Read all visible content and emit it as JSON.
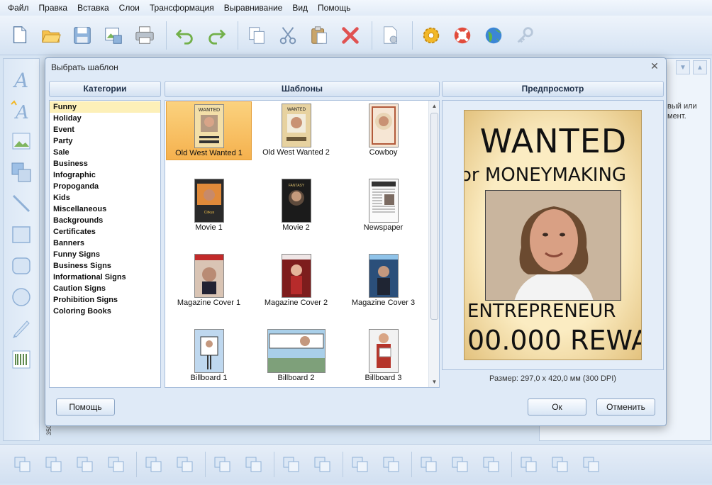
{
  "menu": [
    "Файл",
    "Правка",
    "Вставка",
    "Слои",
    "Трансформация",
    "Выравнивание",
    "Вид",
    "Помощь"
  ],
  "toolbar_icons": [
    "new-document-icon",
    "open-folder-icon",
    "save-icon",
    "export-image-icon",
    "print-icon",
    "undo-icon",
    "redo-icon",
    "copy-icon",
    "cut-icon",
    "paste-icon",
    "delete-icon",
    "page-settings-icon",
    "settings-gear-icon",
    "help-lifebuoy-icon",
    "web-globe-icon",
    "key-icon"
  ],
  "left_tools": [
    "text-icon",
    "curved-text-icon",
    "image-icon",
    "clipart-icon",
    "line-icon",
    "rectangle-icon",
    "rounded-rectangle-icon",
    "ellipse-icon",
    "pencil-icon",
    "barcode-icon"
  ],
  "bottom_icons": [
    "bring-front-icon",
    "send-back-icon",
    "bring-forward-icon",
    "send-backward-icon",
    "group-icon",
    "ungroup-icon",
    "center-horizontal-icon",
    "center-vertical-icon",
    "rotate-left-icon",
    "rotate-right-icon",
    "flip-horizontal-icon",
    "flip-vertical-icon",
    "align-left-icon",
    "align-center-icon",
    "align-right-icon",
    "align-top-icon",
    "align-middle-icon",
    "align-bottom-icon"
  ],
  "right_panel": {
    "text": "вый или\nмент."
  },
  "ruler_label": "350",
  "dialog": {
    "title": "Выбрать шаблон",
    "categories_header": "Категории",
    "templates_header": "Шаблоны",
    "preview_header": "Предпросмотр",
    "categories": [
      "Funny",
      "Holiday",
      "Event",
      "Party",
      "Sale",
      "Business",
      "Infographic",
      "Propoganda",
      "Kids",
      "Miscellaneous",
      "Backgrounds",
      "Certificates",
      "Banners",
      "Funny Signs",
      "Business Signs",
      "Informational Signs",
      "Caution Signs",
      "Prohibition Signs",
      "Coloring Books"
    ],
    "selected_category": 0,
    "templates": [
      {
        "label": "Old West Wanted 1",
        "thumb": "wanted",
        "selected": true
      },
      {
        "label": "Old West Wanted 2",
        "thumb": "wanted2",
        "selected": false
      },
      {
        "label": "Cowboy",
        "thumb": "cowboy",
        "selected": false
      },
      {
        "label": "Movie 1",
        "thumb": "movie",
        "selected": false
      },
      {
        "label": "Movie 2",
        "thumb": "movie2",
        "selected": false
      },
      {
        "label": "Newspaper",
        "thumb": "newspaper",
        "selected": false
      },
      {
        "label": "Magazine Cover 1",
        "thumb": "magazine",
        "selected": false
      },
      {
        "label": "Magazine Cover 2",
        "thumb": "magazine2",
        "selected": false
      },
      {
        "label": "Magazine Cover 3",
        "thumb": "magazine3",
        "selected": false
      },
      {
        "label": "Billboard 1",
        "thumb": "billboard",
        "selected": false
      },
      {
        "label": "Billboard 2",
        "thumb": "billboardwide",
        "selected": false
      },
      {
        "label": "Billboard 3",
        "thumb": "billboard3",
        "selected": false
      }
    ],
    "preview_poster": {
      "line1": "WANTED",
      "line2": "or MONEYMAKING",
      "line3": "ENTREPRENEUR",
      "line4": "00.000 REWA"
    },
    "size_text": "Размер: 297,0 x 420,0 мм (300 DPI)",
    "help_button": "Помощь",
    "ok_button": "Ок",
    "cancel_button": "Отменить"
  }
}
